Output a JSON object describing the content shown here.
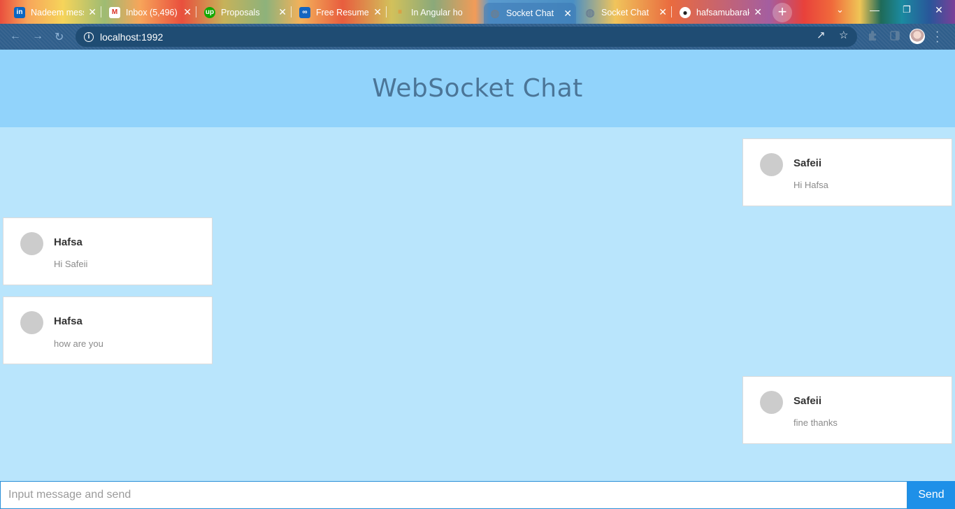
{
  "browser": {
    "tabs": [
      {
        "title": "Nadeem mess",
        "icon": "linkedin-icon",
        "icon_color": "#0a66c2",
        "icon_text": "in"
      },
      {
        "title": "Inbox (5,496)",
        "icon": "gmail-icon",
        "icon_color": "#d93025",
        "icon_text": "M"
      },
      {
        "title": "Proposals",
        "icon": "upwork-icon",
        "icon_color": "#14a800",
        "icon_text": "up"
      },
      {
        "title": "Free Resume",
        "icon": "resume-icon",
        "icon_color": "#1565c0",
        "icon_text": "∞"
      },
      {
        "title": "In Angular ho",
        "icon": "stackoverflow-icon",
        "icon_color": "#f48024",
        "icon_text": "≡"
      },
      {
        "title": "Socket Chat",
        "icon": "globe-icon",
        "icon_color": "#6b7f92",
        "icon_text": "◍"
      },
      {
        "title": "Socket Chat",
        "icon": "globe-icon",
        "icon_color": "#6b7f92",
        "icon_text": "◍"
      },
      {
        "title": "hafsamubarak",
        "icon": "github-icon",
        "icon_color": "#222222",
        "icon_text": "●"
      }
    ],
    "close_glyph": "✕",
    "new_tab_glyph": "+",
    "address": "localhost:1992"
  },
  "header": {
    "title": "WebSocket Chat"
  },
  "messages": [
    {
      "sender": "Safeii",
      "text": "Hi Hafsa",
      "side": "right"
    },
    {
      "sender": "Hafsa",
      "text": "Hi Safeii",
      "side": "left"
    },
    {
      "sender": "Hafsa",
      "text": "how are you",
      "side": "left"
    },
    {
      "sender": "Safeii",
      "text": "fine thanks",
      "side": "right"
    }
  ],
  "composer": {
    "placeholder": "Input message and send",
    "value": "",
    "send_label": "Send"
  },
  "colors": {
    "header_bg": "#91d3fb",
    "body_bg": "#b9e5fc",
    "send_button": "#1e90e8"
  }
}
